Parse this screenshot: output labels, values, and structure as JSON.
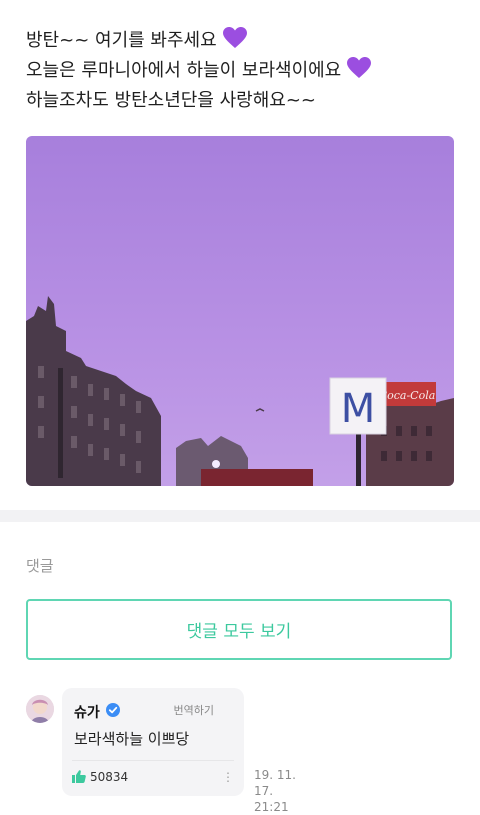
{
  "post": {
    "lines": [
      "방탄~~ 여기를 봐주세요",
      "오늘은 루마니아에서 하늘이 보라색이에요",
      "하늘조차도 방탄소년단을 사랑해요~~"
    ],
    "emoji_icon": "purple-heart-icon"
  },
  "photo": {
    "sign_letter": "M",
    "billboard_text": "Coca-Cola",
    "sky_color": "#b48be2"
  },
  "comments": {
    "label": "댓글",
    "view_all_label": "댓글 모두 보기",
    "items": [
      {
        "author": "슈가",
        "translate_label": "번역하기",
        "text": "보라색하늘 이쁘당",
        "likes": "50834",
        "date": "19. 11. 17.",
        "time": "21:21"
      }
    ]
  },
  "colors": {
    "accent": "#3cc99e",
    "verified": "#3b8df5",
    "heart": "#9b4ee0"
  }
}
